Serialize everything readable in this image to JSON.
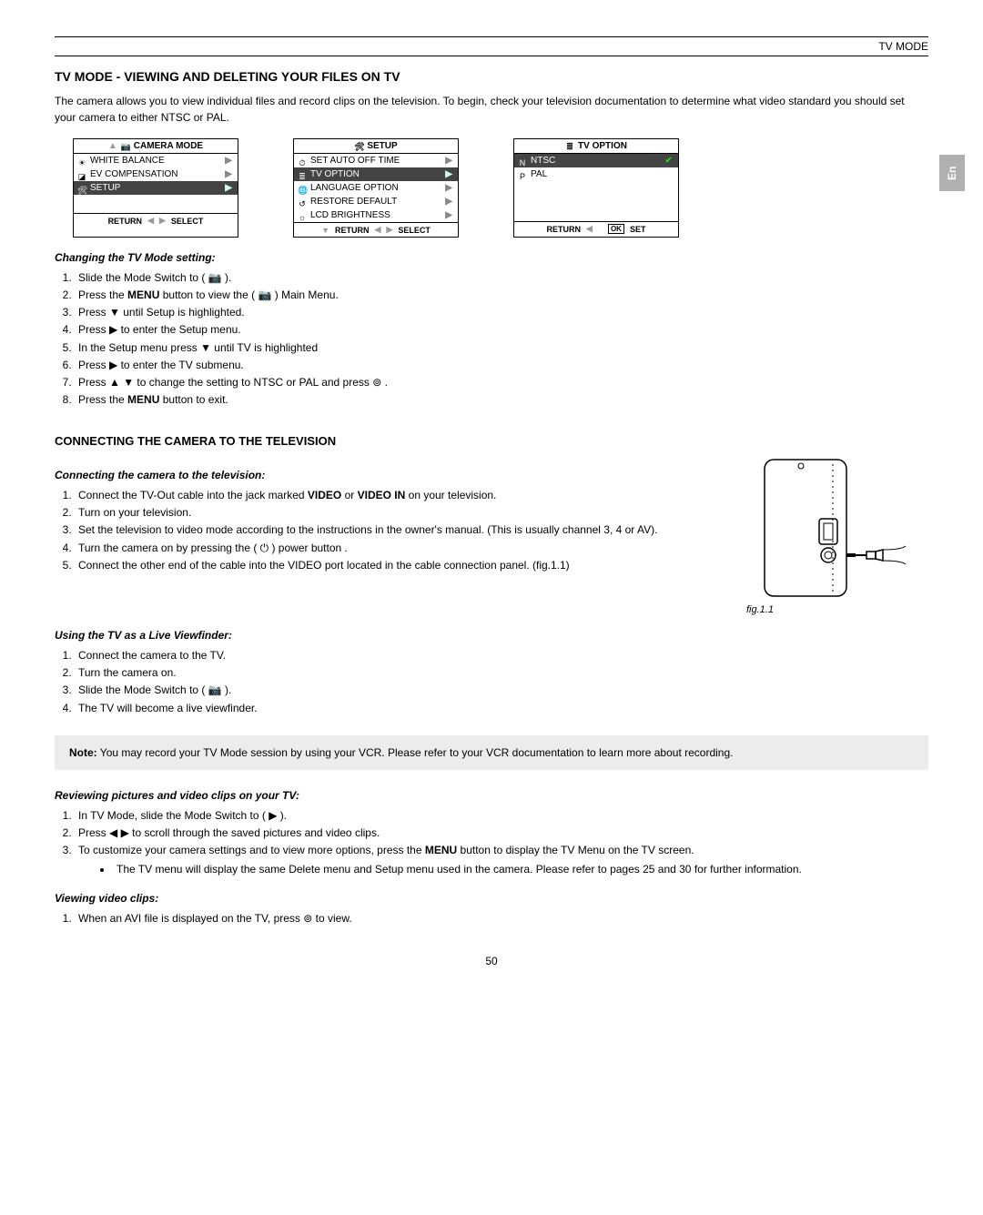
{
  "topbar": {
    "title": "TV MODE"
  },
  "lang_tab": "En",
  "section1": {
    "heading": "TV MODE - VIEWING AND DELETING YOUR FILES ON TV",
    "intro": "The camera allows you to view individual files and record clips on the television. To begin, check your television documentation to determine what video standard you should set your camera to either NTSC or PAL."
  },
  "menus": {
    "camera_mode": {
      "header": "CAMERA MODE",
      "rows": [
        {
          "icon": "wb-icon",
          "label": "WHITE BALANCE",
          "hl": false
        },
        {
          "icon": "ev-icon",
          "label": "EV COMPENSATION",
          "hl": false
        },
        {
          "icon": "setup-icon",
          "label": "SETUP",
          "hl": true
        }
      ],
      "footer_left": "RETURN",
      "footer_right": "SELECT"
    },
    "setup": {
      "header": "SETUP",
      "rows": [
        {
          "icon": "clock-icon",
          "label": "SET AUTO OFF TIME",
          "hl": false
        },
        {
          "icon": "tv-icon",
          "label": "TV OPTION",
          "hl": true
        },
        {
          "icon": "lang-icon",
          "label": "LANGUAGE OPTION",
          "hl": false
        },
        {
          "icon": "restore-icon",
          "label": "RESTORE DEFAULT",
          "hl": false
        },
        {
          "icon": "lcd-icon",
          "label": "LCD BRIGHTNESS",
          "hl": false
        }
      ],
      "footer_left": "RETURN",
      "footer_right": "SELECT"
    },
    "tv_option": {
      "header": "TV  OPTION",
      "rows": [
        {
          "icon": "n-icon",
          "label": "NTSC",
          "hl": true,
          "check": true
        },
        {
          "icon": "p-icon",
          "label": "PAL",
          "hl": false
        }
      ],
      "footer_left": "RETURN",
      "footer_right": "SET",
      "footer_right_box": "OK"
    }
  },
  "change_tv_mode": {
    "subhead": "Changing the TV Mode setting:",
    "steps": {
      "s1a": "Slide the Mode Switch to ( ",
      "s1b": " ).",
      "s2a": "Press the ",
      "s2b": "MENU",
      "s2c": " button to view the ( ",
      "s2d": " ) Main Menu.",
      "s3": "Press  ▼  until Setup is highlighted.",
      "s4": "Press  ▶  to enter the Setup menu.",
      "s5": "In the Setup menu press  ▼  until TV is highlighted",
      "s6": "Press  ▶  to enter the TV submenu.",
      "s7": "Press  ▲ ▼  to change the setting to NTSC or PAL and press  ⊚ .",
      "s8a": "Press the ",
      "s8b": "MENU",
      "s8c": " button to exit."
    }
  },
  "section2": {
    "heading": "CONNECTING THE CAMERA TO THE TELEVISION",
    "sub1": {
      "subhead": "Connecting the camera to the television:",
      "s1a": "Connect the TV-Out cable into the jack marked ",
      "s1b": "VIDEO",
      "s1c": " or ",
      "s1d": "VIDEO IN",
      "s1e": " on your television.",
      "s2": "Turn on your television.",
      "s3": "Set the television to video mode according to the instructions in the owner's manual. (This is usually channel 3, 4 or AV).",
      "s4": "Turn the camera on by pressing the (  ⏻  ) power button .",
      "s5": "Connect the other end of the cable into the VIDEO port located in the cable connection panel. (fig.1.1)"
    },
    "fig_cap": "fig.1.1",
    "sub2": {
      "subhead": "Using the TV as a Live Viewfinder:",
      "s1": "Connect the camera to the TV.",
      "s2": "Turn the camera on.",
      "s3a": "Slide the Mode Switch to ( ",
      "s3b": " ).",
      "s4": "The TV will become a live viewfinder."
    }
  },
  "note": {
    "bold": "Note:",
    "text": " You may record your TV Mode session by using your VCR.  Please refer to your VCR documentation to learn more about recording."
  },
  "review": {
    "subhead": "Reviewing pictures and video clips on your TV:",
    "s1a": "In TV Mode, slide the Mode Switch to ( ",
    "s1b": " ).",
    "s2": "Press  ◀ ▶  to scroll through the saved pictures and video clips.",
    "s3a": "To customize your camera settings and to view more options, press the ",
    "s3b": "MENU",
    "s3c": " button to display the TV Menu on the TV screen.",
    "bullet": "The TV menu will display the same Delete menu and Setup menu used in the camera. Please refer to pages 25 and 30 for further information."
  },
  "viewing": {
    "subhead": "Viewing video clips:",
    "s1": "When an AVI file is displayed on the TV, press  ⊚  to view."
  },
  "page_number": "50"
}
